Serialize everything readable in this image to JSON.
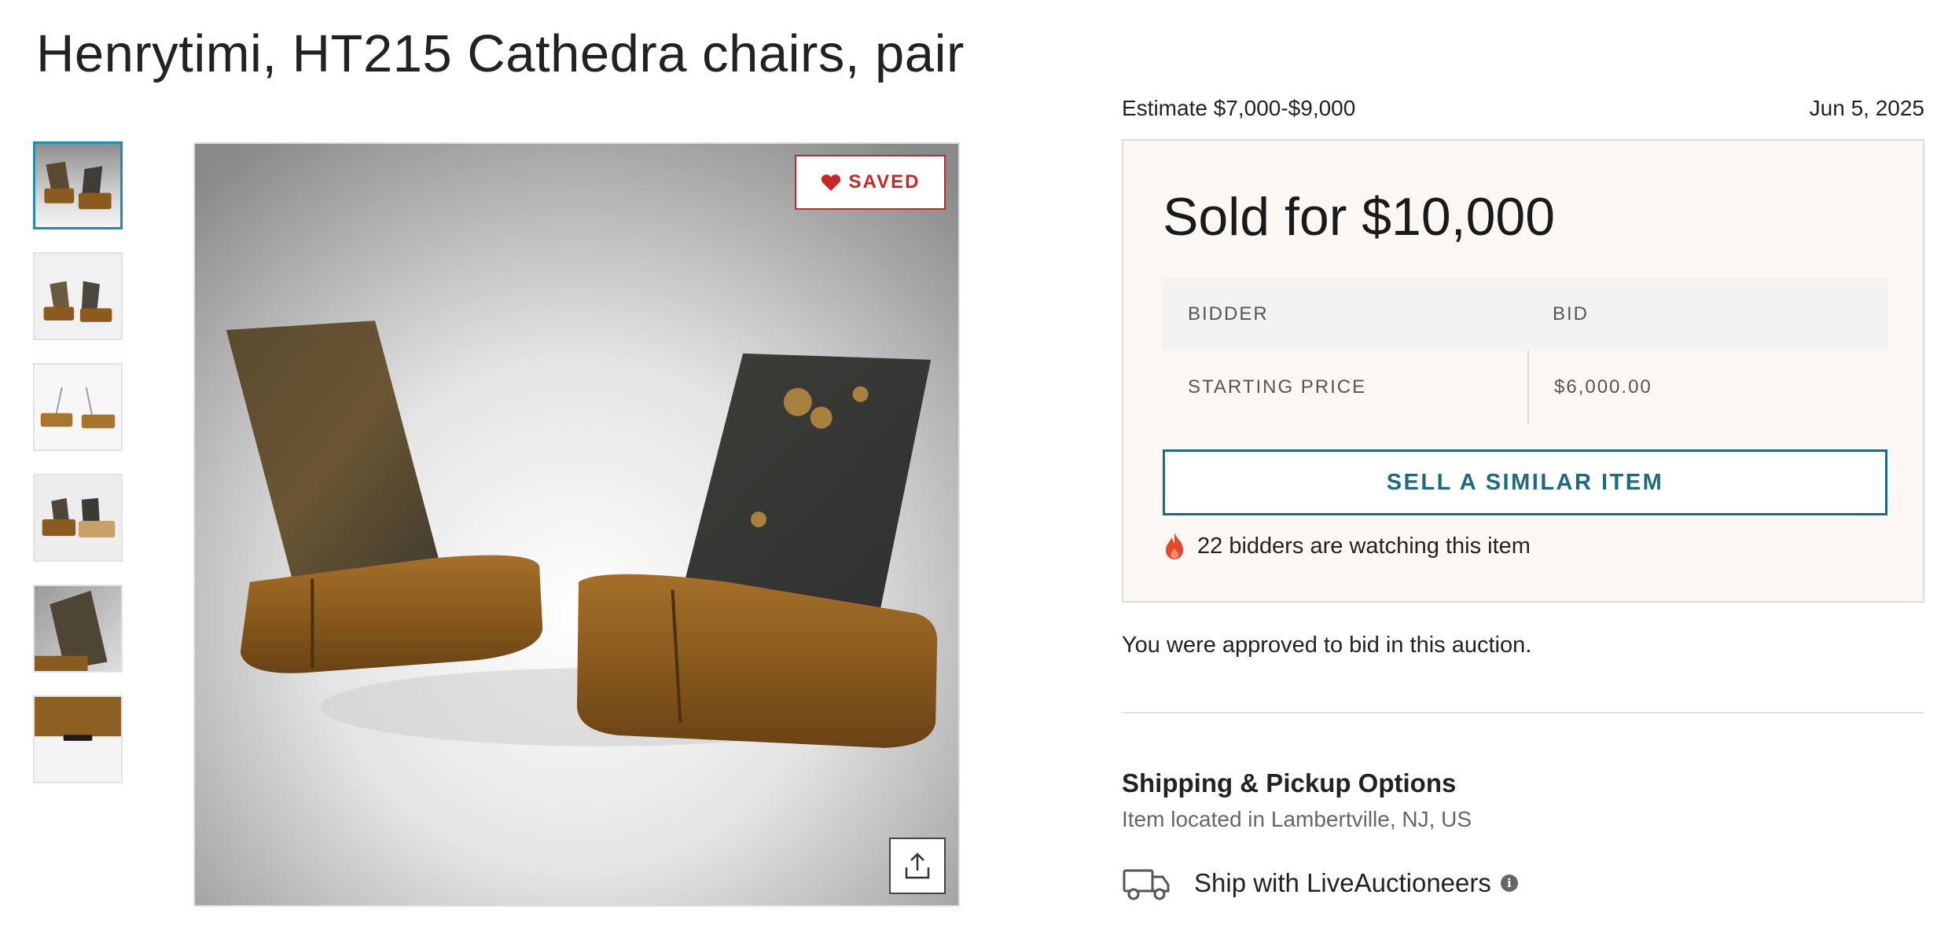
{
  "lot": {
    "title": "Henrytimi, HT215 Cathedra chairs, pair",
    "estimate": "Estimate $7,000-$9,000",
    "date": "Jun 5, 2025"
  },
  "gallery": {
    "thumbnail_count": 6,
    "active_index": 0,
    "saved_label": "SAVED",
    "saved_icon": "heart-icon",
    "share_icon": "share-icon"
  },
  "result": {
    "sold_text": "Sold for $10,000",
    "table_headers": [
      "BIDDER",
      "BID"
    ],
    "rows": [
      {
        "bidder": "STARTING PRICE",
        "bid": "$6,000.00"
      }
    ],
    "sell_similar_label": "SELL A SIMILAR ITEM",
    "watching_text": "22 bidders are watching this item",
    "watching_icon": "flame-icon"
  },
  "approval": {
    "text": "You were approved to bid in this auction."
  },
  "shipping": {
    "title": "Shipping & Pickup Options",
    "location": "Item located in Lambertville, NJ, US",
    "option_label": "Ship with LiveAuctioneers",
    "option_icon": "truck-icon",
    "info_icon": "info-icon"
  },
  "colors": {
    "accent_teal": "#1a6b83",
    "saved_red": "#c62828",
    "card_bg": "#fbf7f4",
    "active_thumb_border": "#1a8fb0"
  }
}
